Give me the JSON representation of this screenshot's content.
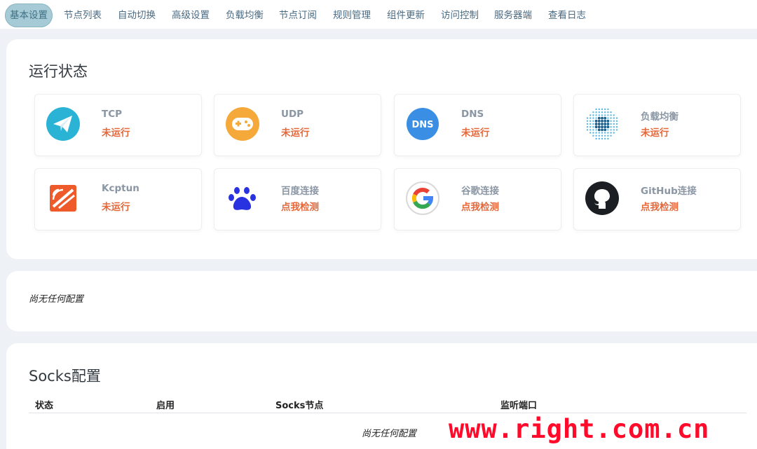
{
  "tabs": [
    {
      "label": "基本设置",
      "active": true
    },
    {
      "label": "节点列表"
    },
    {
      "label": "自动切换"
    },
    {
      "label": "高级设置"
    },
    {
      "label": "负载均衡"
    },
    {
      "label": "节点订阅"
    },
    {
      "label": "规则管理"
    },
    {
      "label": "组件更新"
    },
    {
      "label": "访问控制"
    },
    {
      "label": "服务器端"
    },
    {
      "label": "查看日志"
    }
  ],
  "status": {
    "title": "运行状态",
    "cards": [
      {
        "name": "TCP",
        "status": "未运行",
        "icon": "paper-plane-icon"
      },
      {
        "name": "UDP",
        "status": "未运行",
        "icon": "gamepad-icon"
      },
      {
        "name": "DNS",
        "status": "未运行",
        "icon": "dns-icon",
        "icon_text": "DNS"
      },
      {
        "name": "负载均衡",
        "status": "未运行",
        "icon": "load-balance-icon"
      },
      {
        "name": "Kcptun",
        "status": "未运行",
        "icon": "kcptun-icon"
      },
      {
        "name": "百度连接",
        "status": "点我检测",
        "icon": "baidu-paw-icon"
      },
      {
        "name": "谷歌连接",
        "status": "点我检测",
        "icon": "google-icon"
      },
      {
        "name": "GitHub连接",
        "status": "点我检测",
        "icon": "github-icon"
      }
    ]
  },
  "config_panel": {
    "empty_text": "尚无任何配置"
  },
  "socks": {
    "title": "Socks配置",
    "columns": [
      "状态",
      "启用",
      "Socks节点",
      "监听端口"
    ],
    "empty_text": "尚无任何配置"
  },
  "watermark": "www.right.com.cn",
  "colors": {
    "accent_status": "#e5683a",
    "active_tab_bg": "#a7cbd6",
    "tab_text": "#4a6a82",
    "watermark": "#ff0a2a"
  }
}
